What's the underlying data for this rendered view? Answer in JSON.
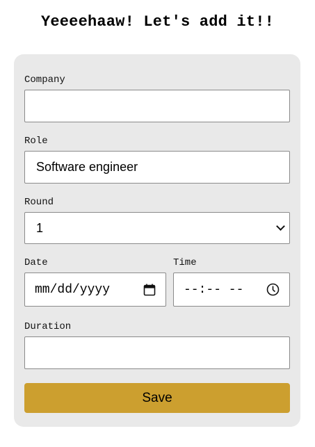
{
  "page": {
    "title": "Yeeeehaaw! Let's add it!!"
  },
  "form": {
    "company": {
      "label": "Company",
      "value": ""
    },
    "role": {
      "label": "Role",
      "value": "Software engineer"
    },
    "round": {
      "label": "Round",
      "selected": "1"
    },
    "date": {
      "label": "Date",
      "placeholder": "mm/dd/yyyy",
      "icon": "calendar-icon"
    },
    "time": {
      "label": "Time",
      "placeholder": "--:-- --",
      "icon": "clock-icon"
    },
    "duration": {
      "label": "Duration",
      "value": ""
    },
    "save_label": "Save"
  },
  "colors": {
    "card_background": "#e9e9e9",
    "save_button": "#cc9f2f"
  }
}
